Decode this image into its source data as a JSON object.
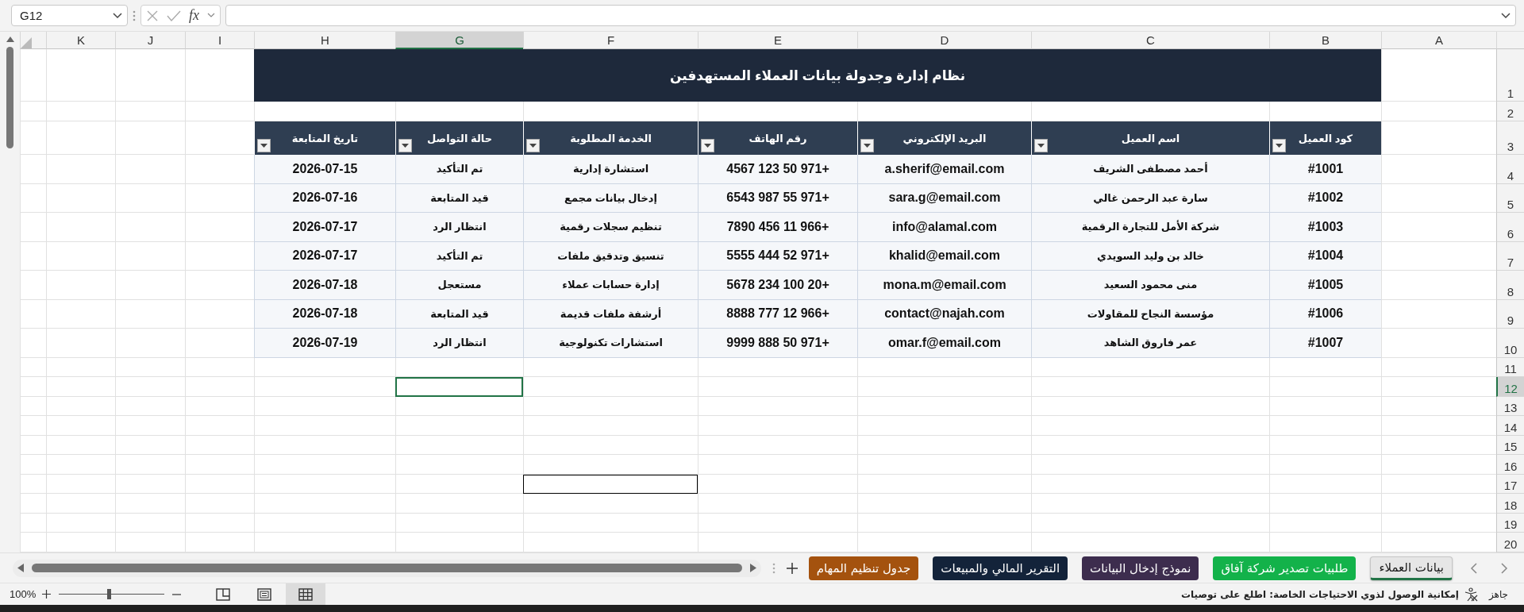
{
  "name_box": "G12",
  "function_label": "fx",
  "sheet": {
    "columns": [
      {
        "letter": "A",
        "selected": false
      },
      {
        "letter": "B",
        "selected": false
      },
      {
        "letter": "C",
        "selected": false
      },
      {
        "letter": "D",
        "selected": false
      },
      {
        "letter": "E",
        "selected": false
      },
      {
        "letter": "F",
        "selected": false
      },
      {
        "letter": "G",
        "selected": true
      },
      {
        "letter": "H",
        "selected": false
      },
      {
        "letter": "I",
        "selected": false
      },
      {
        "letter": "J",
        "selected": false
      },
      {
        "letter": "K",
        "selected": false
      }
    ],
    "rows": [
      {
        "number": "1",
        "selected": false
      },
      {
        "number": "2",
        "selected": false
      },
      {
        "number": "3",
        "selected": false
      },
      {
        "number": "4",
        "selected": false
      },
      {
        "number": "5",
        "selected": false
      },
      {
        "number": "6",
        "selected": false
      },
      {
        "number": "7",
        "selected": false
      },
      {
        "number": "8",
        "selected": false
      },
      {
        "number": "9",
        "selected": false
      },
      {
        "number": "10",
        "selected": false
      },
      {
        "number": "11",
        "selected": false
      },
      {
        "number": "12",
        "selected": true
      },
      {
        "number": "13",
        "selected": false
      },
      {
        "number": "14",
        "selected": false
      },
      {
        "number": "15",
        "selected": false
      },
      {
        "number": "16",
        "selected": false
      },
      {
        "number": "17",
        "selected": false
      },
      {
        "number": "18",
        "selected": false
      },
      {
        "number": "19",
        "selected": false
      },
      {
        "number": "20",
        "selected": false
      }
    ],
    "shapes": [
      {
        "kind": "rectangle"
      }
    ]
  },
  "table": {
    "title": "نظام إدارة وجدولة بيانات العملاء المستهدفين",
    "columns": [
      {
        "heading": "كود العميل",
        "filter_button": true
      },
      {
        "heading": "اسم العميل",
        "filter_button": true
      },
      {
        "heading": "البريد الإلكتروني",
        "filter_button": true
      },
      {
        "heading": "رقم الهاتف",
        "filter_button": true
      },
      {
        "heading": "الخدمة المطلوبة",
        "filter_button": true
      },
      {
        "heading": "حالة التواصل",
        "filter_button": true
      },
      {
        "heading": "تاريخ المتابعة",
        "filter_button": true
      }
    ],
    "rows": [
      {
        "cells": [
          "#1001",
          "أحمد مصطفى الشريف",
          "a.sherif@email.com",
          "+971 50 123 4567",
          "استشارة إدارية",
          "تم التأكيد",
          "2026-07-15"
        ]
      },
      {
        "cells": [
          "#1002",
          "سارة عبد الرحمن غالي",
          "sara.g@email.com",
          "+971 55 987 6543",
          "إدخال بيانات مجمع",
          "قيد المتابعة",
          "2026-07-16"
        ]
      },
      {
        "cells": [
          "#1003",
          "شركة الأمل للتجارة الرقمية",
          "info@alamal.com",
          "+966 11 456 7890",
          "تنظيم سجلات رقمية",
          "انتظار الرد",
          "2026-07-17"
        ]
      },
      {
        "cells": [
          "#1004",
          "خالد بن وليد السويدي",
          "khalid@email.com",
          "+971 52 444 5555",
          "تنسيق وتدقيق ملفات",
          "تم التأكيد",
          "2026-07-17"
        ]
      },
      {
        "cells": [
          "#1005",
          "منى محمود السعيد",
          "mona.m@email.com",
          "+20 100 234 5678",
          "إدارة حسابات عملاء",
          "مستعجل",
          "2026-07-18"
        ]
      },
      {
        "cells": [
          "#1006",
          "مؤسسة النجاح للمقاولات",
          "contact@najah.com",
          "+966 12 777 8888",
          "أرشفة ملفات قديمة",
          "قيد المتابعة",
          "2026-07-18"
        ]
      },
      {
        "cells": [
          "#1007",
          "عمر فاروق الشاهد",
          "omar.f@email.com",
          "+971 50 888 9999",
          "استشارات تكنولوجية",
          "انتظار الرد",
          "2026-07-19"
        ]
      }
    ]
  },
  "sheet_tabs": [
    {
      "label": "بيانات العملاء",
      "selected": true
    },
    {
      "label": "طلبيات تصدير شركة آفاق",
      "selected": false,
      "color": "#13b24a"
    },
    {
      "label": "نموذج إدخال البيانات",
      "selected": false,
      "color": "#3d2d4e"
    },
    {
      "label": "التقرير المالي والمبيعات",
      "selected": false,
      "color": "#13233a"
    },
    {
      "label": "جدول تنظيم المهام",
      "selected": false,
      "color": "#a4520e"
    }
  ],
  "status_bar": {
    "status": "جاهز",
    "accessibility": "إمكانية الوصول لذوي الاحتياجات الخاصة: اطلع على توصيات",
    "zoom": "100%",
    "zoom_slider": {
      "level": 0.47
    },
    "views": [
      {
        "kind": "page_break",
        "selected": false
      },
      {
        "kind": "page_layout",
        "selected": false
      },
      {
        "kind": "normal",
        "selected": true
      }
    ]
  }
}
